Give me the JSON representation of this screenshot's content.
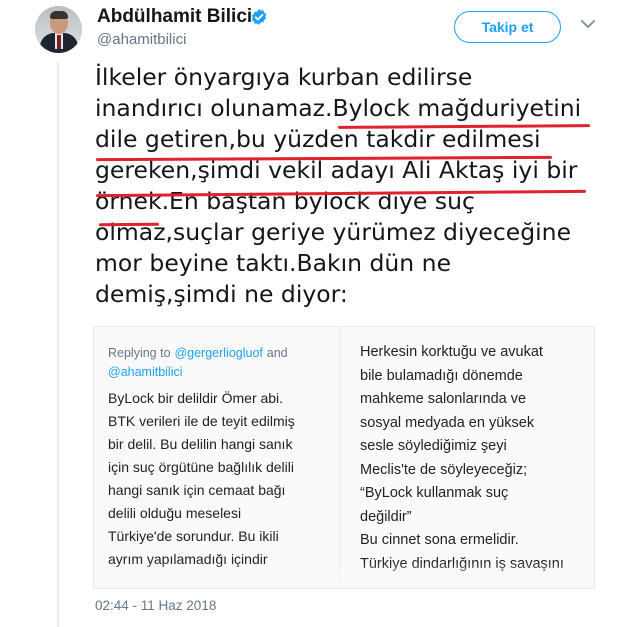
{
  "user": {
    "name": "Abdülhamit Bilici",
    "handle": "@ahamitbilici",
    "follow_label": "Takip et"
  },
  "tweet": {
    "lines": [
      "İlkeler önyargıya kurban edilirse",
      "inandırıcı olunamaz.Bylock mağduriyetini",
      "dile getiren,bu yüzden takdir edilmesi",
      "gereken,şimdi vekil adayı Ali Aktaş iyi bir",
      "örnek.En baştan bylock diye suç",
      "olmaz,suçlar geriye yürümez diyeceğine",
      "mor beyine taktı.Bakın dün ne",
      "demiş,şimdi ne diyor:"
    ]
  },
  "media": {
    "left": {
      "reply_prefix": "Replying to",
      "reply_mention_1": "@gergerliogluof",
      "reply_and": "and",
      "reply_mention_2": "@ahamitbilici",
      "lines": [
        "ByLock bir delildir Ömer abi.",
        "BTK verileri ile de teyit edilmiş",
        "bir delil. Bu delilin hangi sanık",
        "için suç örgütüne bağlılık delili",
        "hangi sanık için cemaat bağı",
        "delili olduğu meselesi",
        "Türkiye'de sorundur. Bu ikili",
        "ayrım yapılamadığı içindir"
      ]
    },
    "right": {
      "lines": [
        "Herkesin korktuğu ve avukat",
        "bile bulamadığı dönemde",
        "mahkeme salonlarında ve",
        "sosyal medyada en yüksek",
        "sesle söylediğimiz şeyi",
        "Meclis'te de söyleyeceğiz;",
        "“ByLock kullanmak suç",
        "değildir”",
        "Bu cinnet sona ermelidir.",
        "Türkiye dindarlığının iş savaşını"
      ]
    }
  },
  "timestamp": "02:44 - 11 Haz 2018",
  "colors": {
    "accent": "#1da1f2",
    "underline": "#e0212e",
    "secondary_text": "#657786"
  },
  "icons": [
    "verified-badge-icon",
    "chevron-down-icon"
  ]
}
